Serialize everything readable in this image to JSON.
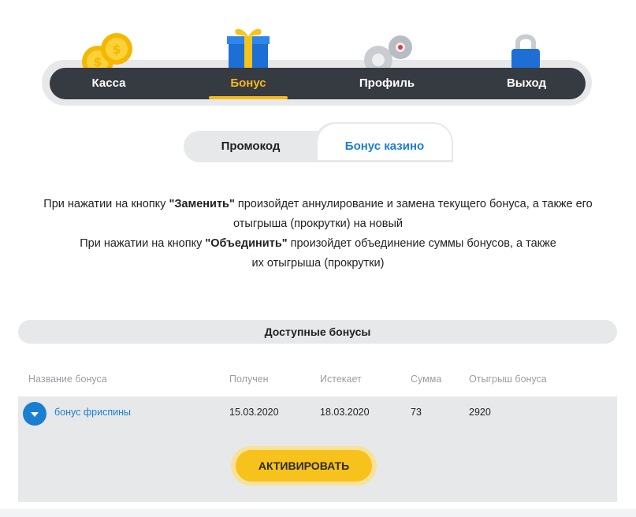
{
  "nav": {
    "items": [
      {
        "label": "Касса",
        "icon": "coins-icon",
        "active": false
      },
      {
        "label": "Бонус",
        "icon": "gift-icon",
        "active": true
      },
      {
        "label": "Профиль",
        "icon": "gears-icon",
        "active": false
      },
      {
        "label": "Выход",
        "icon": "padlock-icon",
        "active": false
      }
    ],
    "accent_color": "#f7b916"
  },
  "tabs": [
    {
      "label": "Промокод",
      "active": false
    },
    {
      "label": "Бонус казино",
      "active": true
    }
  ],
  "info": {
    "line1_prefix": "При нажатии на кнопку ",
    "line1_bold": "\"Заменить\"",
    "line1_suffix": " произойдет аннулирование и замена текущего бонуса, а также его отыгрыша (прокрутки) на новый",
    "line2_prefix": "При нажатии на кнопку ",
    "line2_bold": "\"Объединить\"",
    "line2_suffix": " произойдет объединение суммы бонусов, а также их отыгрыша (прокрутки)"
  },
  "bonuses": {
    "title": "Доступные бонусы",
    "columns": [
      "Название бонуса",
      "Получен",
      "Истекает",
      "Сумма",
      "Отыгрыш бонуса"
    ],
    "rows": [
      {
        "name": "бонус фриспины",
        "received": "15.03.2020",
        "expires": "18.03.2020",
        "amount": "73",
        "wager": "2920"
      }
    ],
    "activate_label": "АКТИВИРОВАТЬ"
  },
  "colors": {
    "dark_bar": "#363a41",
    "link_blue": "#1a7fd1",
    "button_yellow": "#f7c21b",
    "panel_gray": "#e7e8ea"
  }
}
